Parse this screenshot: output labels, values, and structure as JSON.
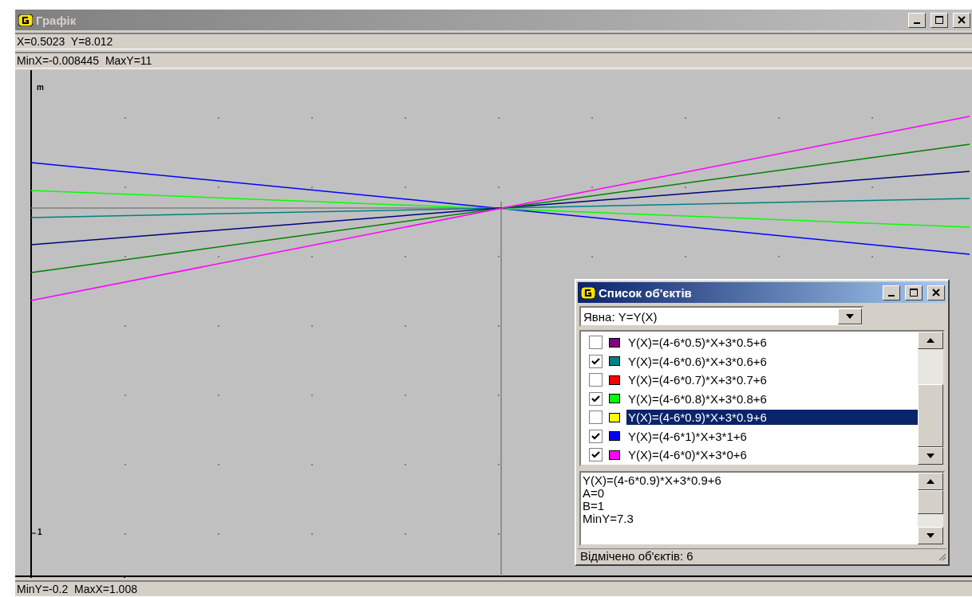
{
  "window": {
    "title": "Графік"
  },
  "status_top": [
    "X=0.5023  Y=8.012",
    "MinX=-0.008445  MaxY=11"
  ],
  "plot": {
    "y_axis_label": "m",
    "y_tick": "1"
  },
  "status_bottom": "MinY=-0.2  MaxX=1.008",
  "objects_window": {
    "title": "Список об'єктів",
    "type_select": "Явна: Y=Y(X)",
    "items": [
      {
        "formula": "Y(X)=(4-6*0.5)*X+3*0.5+6",
        "color": "#800080",
        "checked": false,
        "selected": false
      },
      {
        "formula": "Y(X)=(4-6*0.6)*X+3*0.6+6",
        "color": "#008080",
        "checked": true,
        "selected": false
      },
      {
        "formula": "Y(X)=(4-6*0.7)*X+3*0.7+6",
        "color": "#ff0000",
        "checked": false,
        "selected": false
      },
      {
        "formula": "Y(X)=(4-6*0.8)*X+3*0.8+6",
        "color": "#00ff00",
        "checked": true,
        "selected": false
      },
      {
        "formula": "Y(X)=(4-6*0.9)*X+3*0.9+6",
        "color": "#ffff00",
        "checked": false,
        "selected": true
      },
      {
        "formula": "Y(X)=(4-6*1)*X+3*1+6",
        "color": "#0000ff",
        "checked": true,
        "selected": false
      },
      {
        "formula": "Y(X)=(4-6*0)*X+3*0+6",
        "color": "#ff00ff",
        "checked": true,
        "selected": false
      }
    ],
    "details": [
      "Y(X)=(4-6*0.9)*X+3*0.9+6",
      "A=0",
      "B=1",
      "MinY=7.3"
    ],
    "status": "Відмічено об'єктів: 6"
  }
}
